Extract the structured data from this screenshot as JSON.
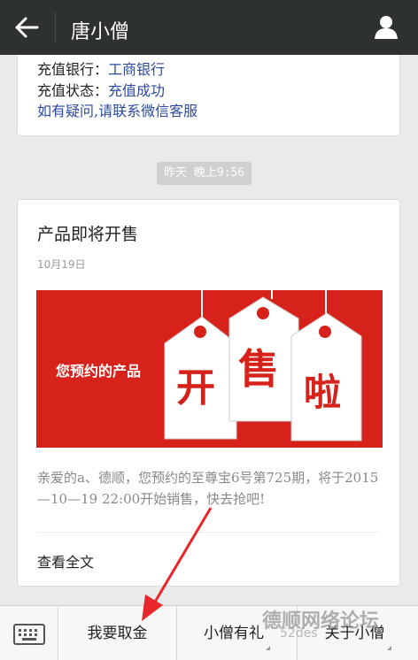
{
  "header": {
    "title": "唐小僧"
  },
  "message1": {
    "bank_label": "充值银行：",
    "bank_value": "工商银行",
    "status_label": "充值状态：",
    "status_value": "充值成功",
    "help_link": "如有疑问,请联系微信客服"
  },
  "timestamp": "昨天 晚上9:56",
  "article": {
    "title": "产品即将开售",
    "date": "10月19日",
    "banner_text": "您预约的产品",
    "banner_tags": [
      "开",
      "售",
      "啦"
    ],
    "description": "亲爱的a、德顺，您预约的至尊宝6号第725期，将于2015—10—19 22:00开始销售，快去抢吧!",
    "read_more": "查看全文"
  },
  "bottom_menu": {
    "items": [
      "我要取金",
      "小僧有礼",
      "关于小僧"
    ]
  },
  "watermark": {
    "line1": "德顺网络论坛",
    "line2": "52des"
  },
  "colors": {
    "topbar": "#2e3132",
    "banner": "#d7221c",
    "link": "#2b4aa0"
  }
}
